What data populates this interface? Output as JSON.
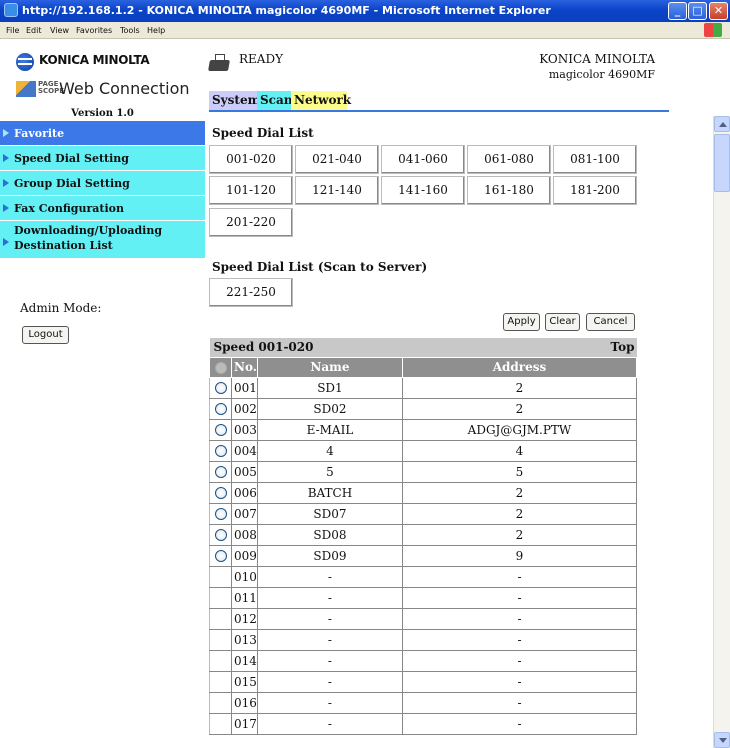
{
  "window": {
    "title": "http://192.168.1.2 - KONICA MINOLTA magicolor 4690MF - Microsoft Internet Explorer",
    "min": "_",
    "max": "□",
    "close": "✕"
  },
  "menu": [
    "File",
    "Edit",
    "View",
    "Favorites",
    "Tools",
    "Help"
  ],
  "left": {
    "logo_text": "KONICA MINOLTA",
    "pagescope_small": "PAGE SCOPE",
    "web_connection": "Web Connection",
    "version": "Version 1.0",
    "nav": [
      {
        "label": "Favorite",
        "active": true
      },
      {
        "label": "Speed Dial Setting",
        "active": false
      },
      {
        "label": "Group Dial Setting",
        "active": false
      },
      {
        "label": "Fax Configuration",
        "active": false
      },
      {
        "label": "Downloading/Uploading\nDestination List",
        "active": false
      }
    ],
    "admin_mode": "Admin Mode:",
    "logout": "Logout"
  },
  "header": {
    "status": "READY",
    "brand": "KONICA MINOLTA",
    "model": "magicolor 4690MF"
  },
  "tabs": [
    "System",
    "Scan",
    "Network"
  ],
  "speed_dial": {
    "title": "Speed Dial List",
    "ranges": [
      "001-020",
      "021-040",
      "041-060",
      "061-080",
      "081-100",
      "101-120",
      "121-140",
      "141-160",
      "161-180",
      "181-200",
      "201-220"
    ],
    "server_title": "Speed Dial List (Scan to Server)",
    "server_ranges": [
      "221-250"
    ]
  },
  "actions": {
    "apply": "Apply",
    "clear": "Clear",
    "cancel": "Cancel"
  },
  "table": {
    "caption": "Speed 001-020",
    "top_link": "Top",
    "columns": {
      "no": "No.",
      "name": "Name",
      "address": "Address"
    },
    "rows": [
      {
        "no": "001",
        "name": "SD1",
        "address": "2",
        "radio": true
      },
      {
        "no": "002",
        "name": "SD02",
        "address": "2",
        "radio": true
      },
      {
        "no": "003",
        "name": "E-MAIL",
        "address": "ADGJ@GJM.PTW",
        "radio": true
      },
      {
        "no": "004",
        "name": "4",
        "address": "4",
        "radio": true
      },
      {
        "no": "005",
        "name": "5",
        "address": "5",
        "radio": true
      },
      {
        "no": "006",
        "name": "BATCH",
        "address": "2",
        "radio": true
      },
      {
        "no": "007",
        "name": "SD07",
        "address": "2",
        "radio": true
      },
      {
        "no": "008",
        "name": "SD08",
        "address": "2",
        "radio": true
      },
      {
        "no": "009",
        "name": "SD09",
        "address": "9",
        "radio": true
      },
      {
        "no": "010",
        "name": "-",
        "address": "-",
        "radio": false
      },
      {
        "no": "011",
        "name": "-",
        "address": "-",
        "radio": false
      },
      {
        "no": "012",
        "name": "-",
        "address": "-",
        "radio": false
      },
      {
        "no": "013",
        "name": "-",
        "address": "-",
        "radio": false
      },
      {
        "no": "014",
        "name": "-",
        "address": "-",
        "radio": false
      },
      {
        "no": "015",
        "name": "-",
        "address": "-",
        "radio": false
      },
      {
        "no": "016",
        "name": "-",
        "address": "-",
        "radio": false
      },
      {
        "no": "017",
        "name": "-",
        "address": "-",
        "radio": false
      }
    ]
  }
}
